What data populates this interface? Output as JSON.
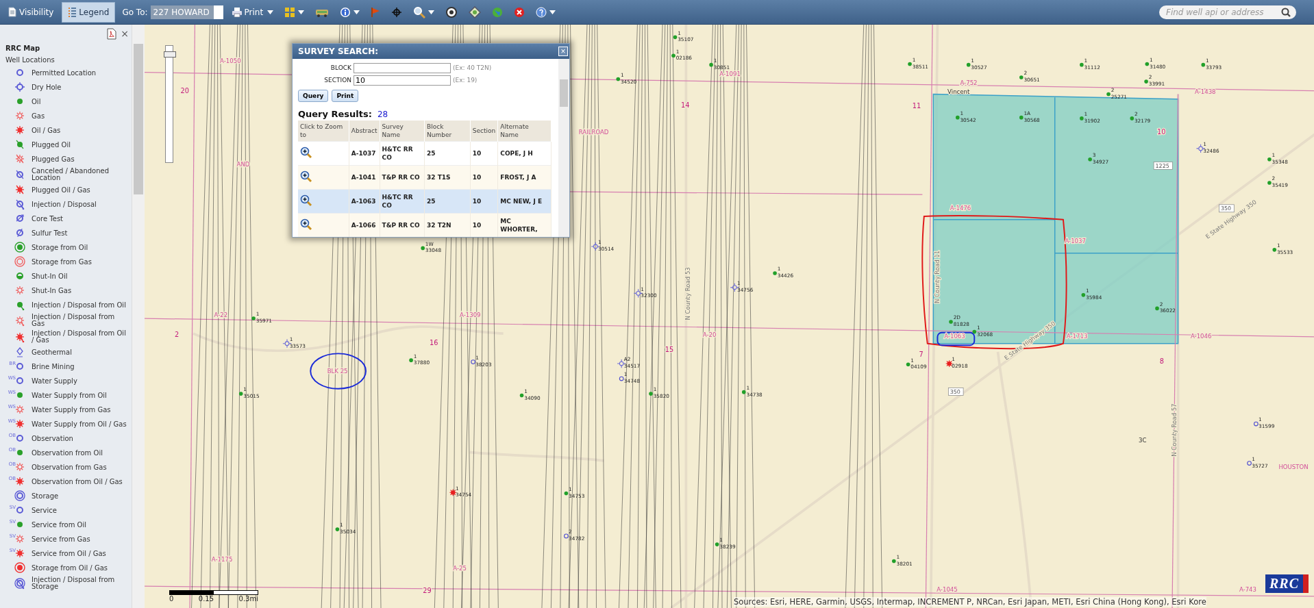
{
  "toolbar": {
    "tabs": [
      {
        "label": "Visibility",
        "selected": false
      },
      {
        "label": "Legend",
        "selected": true
      }
    ],
    "goto": {
      "label": "Go To:",
      "value": "227 HOWARD"
    },
    "print": {
      "label": "Print"
    },
    "search": {
      "placeholder": "Find well api or address"
    }
  },
  "legend": {
    "close": "×",
    "title": "RRC Map",
    "group": "Well Locations",
    "items": [
      {
        "label": "Permitted Location",
        "kind": "circle",
        "color": "#5b5bd6"
      },
      {
        "label": "Dry Hole",
        "kind": "dry",
        "color": "#5b5bd6"
      },
      {
        "label": "Oil",
        "kind": "dot",
        "color": "#2aa02a"
      },
      {
        "label": "Gas",
        "kind": "star-open",
        "color": "#f06060"
      },
      {
        "label": "Oil / Gas",
        "kind": "star",
        "color": "#f03030"
      },
      {
        "label": "Plugged Oil",
        "kind": "dot-slash",
        "color": "#2aa02a"
      },
      {
        "label": "Plugged Gas",
        "kind": "star-open-slash",
        "color": "#f06060"
      },
      {
        "label": "Canceled / Abandoned Location",
        "kind": "circle-slash",
        "color": "#5b5bd6"
      },
      {
        "label": "Plugged Oil / Gas",
        "kind": "star-slash",
        "color": "#f03030"
      },
      {
        "label": "Injection / Disposal",
        "kind": "circle-tail",
        "color": "#5b5bd6"
      },
      {
        "label": "Core Test",
        "kind": "circle-arrow",
        "color": "#5b5bd6"
      },
      {
        "label": "Sulfur Test",
        "kind": "circle-hook",
        "color": "#5b5bd6"
      },
      {
        "label": "Storage from Oil",
        "kind": "ring-dot",
        "color": "#2aa02a"
      },
      {
        "label": "Storage from Gas",
        "kind": "ring-star",
        "color": "#f06060"
      },
      {
        "label": "Shut-In Oil",
        "kind": "half-dot",
        "color": "#2aa02a"
      },
      {
        "label": "Shut-In Gas",
        "kind": "star-open",
        "color": "#f06060"
      },
      {
        "label": "Injection / Disposal from Oil",
        "kind": "dot-tail",
        "color": "#2aa02a"
      },
      {
        "label": "Injection / Disposal from Gas",
        "kind": "star-open-tail",
        "color": "#f06060"
      },
      {
        "label": "Injection / Disposal from Oil / Gas",
        "kind": "star-tail",
        "color": "#f03030"
      },
      {
        "label": "Geothermal",
        "kind": "drop",
        "color": "#5b5bd6"
      },
      {
        "label": "Brine Mining",
        "kind": "circle",
        "color": "#5b5bd6",
        "prefix": "BR"
      },
      {
        "label": "Water Supply",
        "kind": "circle",
        "color": "#5b5bd6",
        "prefix": "WS"
      },
      {
        "label": "Water Supply from Oil",
        "kind": "dot",
        "color": "#2aa02a",
        "prefix": "WS"
      },
      {
        "label": "Water Supply from Gas",
        "kind": "star-open",
        "color": "#f06060",
        "prefix": "WS"
      },
      {
        "label": "Water Supply from Oil / Gas",
        "kind": "star",
        "color": "#f03030",
        "prefix": "WS"
      },
      {
        "label": "Observation",
        "kind": "circle",
        "color": "#5b5bd6",
        "prefix": "OB"
      },
      {
        "label": "Observation from Oil",
        "kind": "dot",
        "color": "#2aa02a",
        "prefix": "OB"
      },
      {
        "label": "Observation from Gas",
        "kind": "star-open",
        "color": "#f06060",
        "prefix": "OB"
      },
      {
        "label": "Observation from Oil / Gas",
        "kind": "star",
        "color": "#f03030",
        "prefix": "OB"
      },
      {
        "label": "Storage",
        "kind": "double-ring",
        "color": "#5b5bd6"
      },
      {
        "label": "Service",
        "kind": "circle",
        "color": "#5b5bd6",
        "prefix": "SV"
      },
      {
        "label": "Service from Oil",
        "kind": "dot",
        "color": "#2aa02a",
        "prefix": "SV"
      },
      {
        "label": "Service from Gas",
        "kind": "star-open",
        "color": "#f06060",
        "prefix": "SV"
      },
      {
        "label": "Service from Oil / Gas",
        "kind": "star",
        "color": "#f03030",
        "prefix": "SV"
      },
      {
        "label": "Storage from Oil / Gas",
        "kind": "ring-dot",
        "color": "#f03030"
      },
      {
        "label": "Injection / Disposal from Storage",
        "kind": "double-ring-slash",
        "color": "#5b5bd6"
      }
    ]
  },
  "survey_search": {
    "title": "SURVEY SEARCH:",
    "close": "×",
    "fields": [
      {
        "label": "BLOCK",
        "hint": "(Ex: 40 T2N)"
      },
      {
        "label": "SECTION",
        "value": "10",
        "hint": "(Ex: 19)"
      }
    ],
    "buttons": [
      "Query",
      "Print"
    ],
    "results_label": "Query Results:",
    "results_count": "28",
    "columns": [
      "Click to Zoom to",
      "Abstract",
      "Survey Name",
      "Block Number",
      "Section",
      "Alternate Name"
    ],
    "rows": [
      {
        "abstract": "A-1037",
        "survey": "H&TC RR CO",
        "block": "25",
        "section": "10",
        "alternate": "COPE, J H",
        "selected": false
      },
      {
        "abstract": "A-1041",
        "survey": "T&P RR CO",
        "block": "32 T1S",
        "section": "10",
        "alternate": "FROST, J A",
        "selected": false
      },
      {
        "abstract": "A-1063",
        "survey": "H&TC RR CO",
        "block": "25",
        "section": "10",
        "alternate": "MC NEW, J E",
        "selected": true
      },
      {
        "abstract": "A-1066",
        "survey": "T&P RR CO",
        "block": "32 T2N",
        "section": "10",
        "alternate": "MC WHORTER,",
        "selected": false
      }
    ]
  },
  "map": {
    "zoom_slider": {
      "level": 0.95
    },
    "wells": [
      {
        "kind": "oil",
        "number": "1",
        "api": "35107"
      },
      {
        "kind": "oil",
        "number": "1",
        "api": "02186"
      },
      {
        "kind": "oil",
        "number": "1",
        "api": "30851"
      },
      {
        "kind": "oil",
        "number": "1",
        "api": "38511"
      },
      {
        "kind": "oil",
        "number": "1",
        "api": "30527"
      },
      {
        "kind": "oil",
        "number": "1",
        "api": "31112"
      },
      {
        "kind": "oil",
        "number": "1",
        "api": "31480"
      },
      {
        "kind": "oil",
        "number": "1",
        "api": "33793"
      },
      {
        "kind": "oil",
        "number": "1",
        "api": "34520"
      },
      {
        "kind": "oil",
        "number": "2",
        "api": "30651"
      },
      {
        "kind": "oil",
        "number": "2",
        "api": "33991"
      },
      {
        "kind": "oil",
        "number": "2",
        "api": "25271"
      },
      {
        "kind": "oil",
        "number": "1",
        "api": "30542"
      },
      {
        "kind": "oil",
        "number": "1A",
        "api": "30568"
      },
      {
        "kind": "oil",
        "number": "1",
        "api": "31902"
      },
      {
        "kind": "oil",
        "number": "2",
        "api": "32179"
      },
      {
        "kind": "dry",
        "number": "1",
        "api": "32486"
      },
      {
        "kind": "oil",
        "number": "3",
        "api": "34927"
      },
      {
        "kind": "oil",
        "number": "1",
        "api": "35348"
      },
      {
        "kind": "oil",
        "number": "2",
        "api": "35419"
      },
      {
        "kind": "oil",
        "number": "1W",
        "api": "33048"
      },
      {
        "kind": "dry",
        "number": "1",
        "api": "30514"
      },
      {
        "kind": "oil",
        "number": "1",
        "api": "35533"
      },
      {
        "kind": "oil",
        "number": "1",
        "api": "34426"
      },
      {
        "kind": "dry",
        "number": "1",
        "api": "32300"
      },
      {
        "kind": "dry",
        "number": "1",
        "api": "34756"
      },
      {
        "kind": "oil",
        "number": "1",
        "api": "35984"
      },
      {
        "kind": "oil",
        "number": "2",
        "api": "36022"
      },
      {
        "kind": "oil",
        "number": "1",
        "api": "35971"
      },
      {
        "kind": "oil",
        "number": "2D",
        "api": "81828"
      },
      {
        "kind": "oil",
        "number": "1",
        "api": "32068"
      },
      {
        "kind": "dry",
        "number": "1",
        "api": "33573"
      },
      {
        "kind": "oil",
        "number": "1",
        "api": "37880"
      },
      {
        "kind": "permitted",
        "number": "1",
        "api": "38203"
      },
      {
        "kind": "dry",
        "number": "A2",
        "api": "34517"
      },
      {
        "kind": "oil",
        "number": "1",
        "api": "04109"
      },
      {
        "kind": "oilgas",
        "number": "1",
        "api": "02918"
      },
      {
        "kind": "permitted",
        "number": "1",
        "api": "34748"
      },
      {
        "kind": "oil",
        "number": "1",
        "api": "35015"
      },
      {
        "kind": "oil",
        "number": "1",
        "api": "34090"
      },
      {
        "kind": "oil",
        "number": "1",
        "api": "35820"
      },
      {
        "kind": "oil",
        "number": "1",
        "api": "34738"
      },
      {
        "kind": "permitted",
        "number": "1",
        "api": "31599"
      },
      {
        "kind": "permitted",
        "number": "1",
        "api": "35727"
      },
      {
        "kind": "oilgas",
        "number": "1",
        "api": "34754"
      },
      {
        "kind": "oil",
        "number": "1",
        "api": "34753"
      },
      {
        "kind": "oil",
        "number": "1",
        "api": "35034"
      },
      {
        "kind": "permitted",
        "number": "2",
        "api": "34782"
      },
      {
        "kind": "oil",
        "number": "1",
        "api": "38239"
      },
      {
        "kind": "oil",
        "number": "1",
        "api": "38201"
      }
    ],
    "labels": [
      {
        "text": "A-1050",
        "kind": "abstract"
      },
      {
        "text": "A-1091",
        "kind": "abstract"
      },
      {
        "text": "A-752",
        "kind": "abstract"
      },
      {
        "text": "20",
        "kind": "section"
      },
      {
        "text": "Vincent",
        "kind": "place"
      },
      {
        "text": "A-1438",
        "kind": "abstract"
      },
      {
        "text": "14",
        "kind": "section"
      },
      {
        "text": "11",
        "kind": "section"
      },
      {
        "text": "RAILROAD",
        "kind": "abstract"
      },
      {
        "text": "10",
        "kind": "section"
      },
      {
        "text": "AND",
        "kind": "abstract"
      },
      {
        "text": "1225",
        "kind": "shield"
      },
      {
        "text": "A-1476",
        "kind": "abstract"
      },
      {
        "text": "350",
        "kind": "shield"
      },
      {
        "text": "E State Highway 350",
        "kind": "road"
      },
      {
        "text": "A-1037",
        "kind": "abstract"
      },
      {
        "text": "N County Road 11",
        "kind": "road"
      },
      {
        "text": "N County Road 53",
        "kind": "road"
      },
      {
        "text": "A-22",
        "kind": "abstract"
      },
      {
        "text": "A-1309",
        "kind": "abstract"
      },
      {
        "text": "2",
        "kind": "section"
      },
      {
        "text": "A-20",
        "kind": "abstract"
      },
      {
        "text": "A-1063",
        "kind": "abstract"
      },
      {
        "text": "A-1713",
        "kind": "abstract"
      },
      {
        "text": "A-1046",
        "kind": "abstract"
      },
      {
        "text": "16",
        "kind": "section"
      },
      {
        "text": "15",
        "kind": "section"
      },
      {
        "text": "E State Highway 350",
        "kind": "road"
      },
      {
        "text": "7",
        "kind": "section"
      },
      {
        "text": "8",
        "kind": "section"
      },
      {
        "text": "BLK 25",
        "kind": "abstract"
      },
      {
        "text": "350",
        "kind": "shield"
      },
      {
        "text": "N County Road 57",
        "kind": "road"
      },
      {
        "text": "3C",
        "kind": "place"
      },
      {
        "text": "HOUSTON",
        "kind": "abstract"
      },
      {
        "text": "A-1175",
        "kind": "abstract"
      },
      {
        "text": "A-25",
        "kind": "abstract"
      },
      {
        "text": "29",
        "kind": "section"
      },
      {
        "text": "A-1045",
        "kind": "abstract"
      },
      {
        "text": "A-743",
        "kind": "abstract"
      }
    ],
    "scale": [
      "0",
      "0.15",
      "0.3mi"
    ],
    "attribution": "Sources: Esri, HERE, Garmin, USGS, Intermap, INCREMENT P, NRCan, Esri Japan, METI, Esri China (Hong Kong), Esri Kore",
    "logo": "RRC"
  }
}
